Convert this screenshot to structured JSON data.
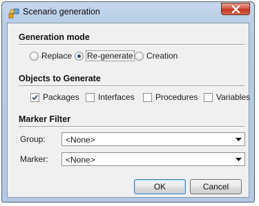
{
  "window": {
    "title": "Scenario generation",
    "close_label": "Close"
  },
  "generation_mode": {
    "heading": "Generation mode",
    "options": [
      {
        "label": "Replace",
        "selected": false
      },
      {
        "label": "Re-generate",
        "selected": true
      },
      {
        "label": "Creation",
        "selected": false
      }
    ]
  },
  "objects": {
    "heading": "Objects to Generate",
    "items": [
      {
        "label": "Packages",
        "checked": true
      },
      {
        "label": "Interfaces",
        "checked": false
      },
      {
        "label": "Procedures",
        "checked": false
      },
      {
        "label": "Variables",
        "checked": false
      }
    ]
  },
  "marker_filter": {
    "heading": "Marker Filter",
    "group": {
      "label": "Group:",
      "value": "<None>"
    },
    "marker": {
      "label": "Marker:",
      "value": "<None>"
    }
  },
  "buttons": {
    "ok": "OK",
    "cancel": "Cancel"
  }
}
